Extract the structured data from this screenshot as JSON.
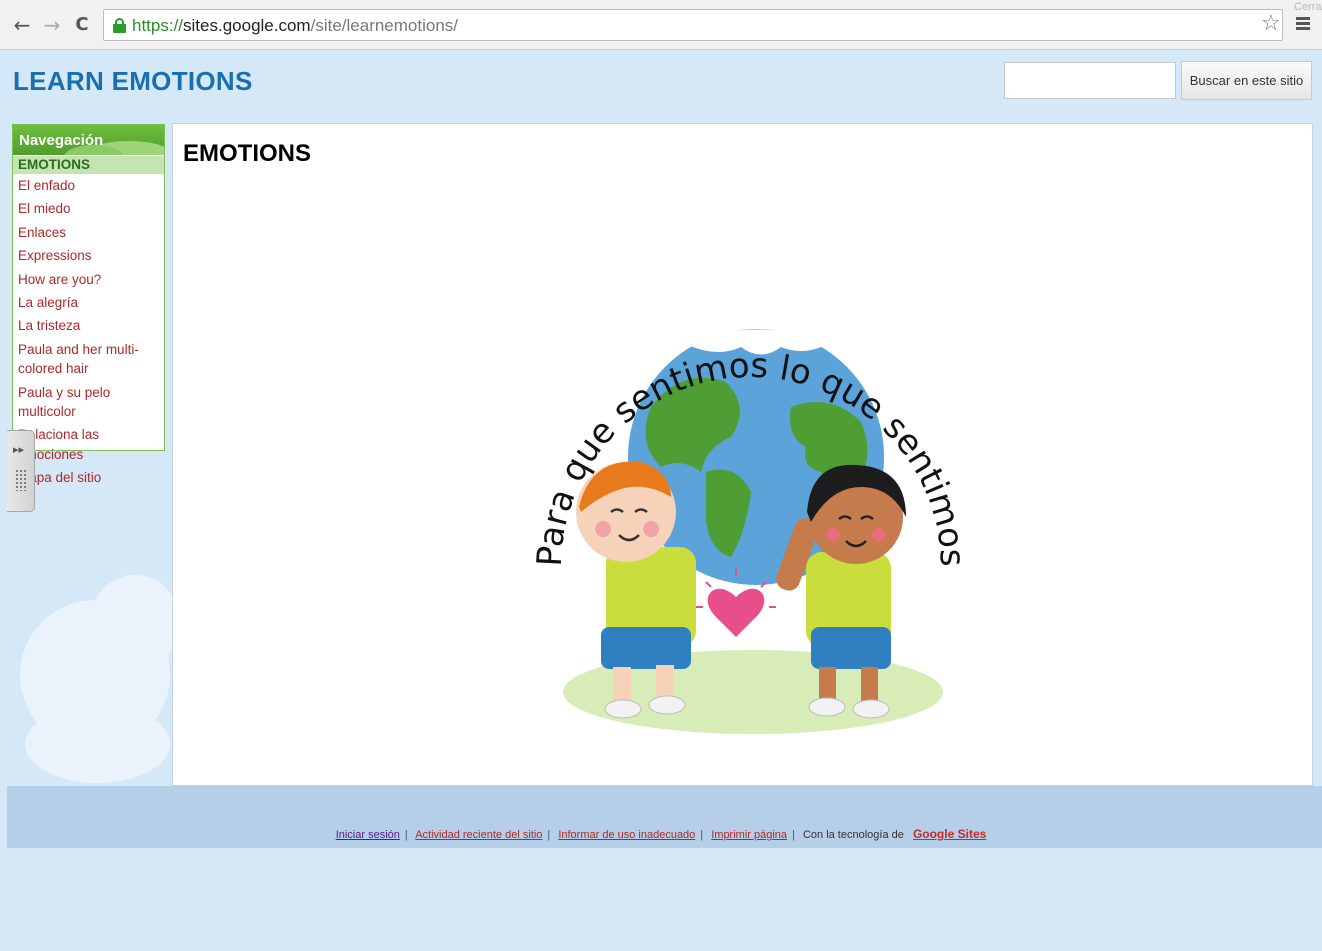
{
  "browser": {
    "url_scheme": "https://",
    "url_host": "sites.google.com",
    "url_path": "/site/learnemotions/",
    "close_hint": "Cerrar"
  },
  "site": {
    "title": "LEARN EMOTIONS",
    "search_placeholder": "",
    "search_button": "Buscar en este sitio"
  },
  "navigation": {
    "header": "Navegación",
    "items": [
      {
        "label": "EMOTIONS",
        "active": true
      },
      {
        "label": "El enfado"
      },
      {
        "label": "El miedo"
      },
      {
        "label": "Enlaces"
      },
      {
        "label": "Expressions"
      },
      {
        "label": "How are you?"
      },
      {
        "label": "La alegría"
      },
      {
        "label": "La tristeza"
      },
      {
        "label": "Paula and her multi-colored hair"
      },
      {
        "label": "Paula y su pelo multicolor"
      },
      {
        "label": "Relaciona las emociones"
      },
      {
        "label": "Mapa del sitio"
      }
    ]
  },
  "main": {
    "page_title": "EMOTIONS",
    "illustration": {
      "caption": "Para que sentimos lo que sentimos",
      "icon": "children-holding-globe-illustration"
    }
  },
  "footer": {
    "links": [
      "Iniciar sesión",
      "Actividad reciente del sitio",
      "Informar de uso inadecuado",
      "Imprimir página"
    ],
    "powered_by": "Con la tecnología de",
    "brand": "Google Sites"
  },
  "colors": {
    "accent": "#1a6fb0",
    "nav_green": "#5aa834",
    "link_red": "#b0282a",
    "background": "#d4e8f7"
  }
}
